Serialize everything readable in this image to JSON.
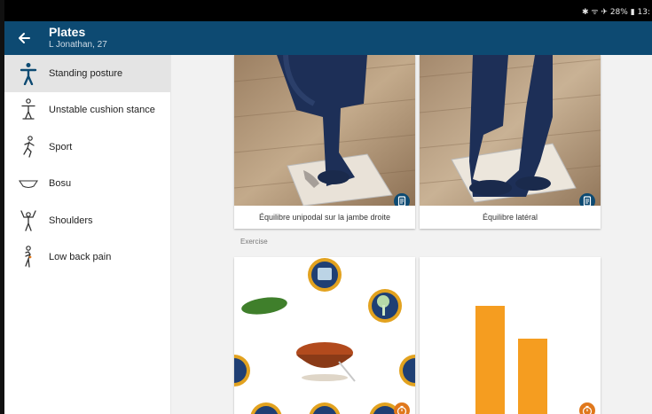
{
  "status_bar": {
    "text": "✱ ᯤ ✈ 28% ▮ 13:"
  },
  "app_bar": {
    "title": "Plates",
    "subtitle": "L Jonathan, 27",
    "back_icon": "arrow-left-icon"
  },
  "sidebar": {
    "items": [
      {
        "label": "Standing posture",
        "icon": "standing-figure-icon",
        "active": true
      },
      {
        "label": "Unstable cushion stance",
        "icon": "cushion-stance-icon",
        "active": false
      },
      {
        "label": "Sport",
        "icon": "running-figure-icon",
        "active": false
      },
      {
        "label": "Bosu",
        "icon": "bosu-icon",
        "active": false
      },
      {
        "label": "Shoulders",
        "icon": "shoulders-figure-icon",
        "active": false
      },
      {
        "label": "Low back pain",
        "icon": "back-pain-figure-icon",
        "active": false
      }
    ]
  },
  "cards": {
    "top_left": {
      "caption": "Équilibre unipodal sur la jambe droite",
      "badge_icon": "document-icon"
    },
    "top_right": {
      "caption": "Équilibre latéral",
      "badge_icon": "document-icon"
    }
  },
  "exercise_section": {
    "label": "Exercise"
  },
  "bottom_cards": {
    "left": {
      "badge_icon": "timer-icon",
      "image": "food-circles-illustration"
    },
    "right": {
      "badge_icon": "timer-icon"
    }
  },
  "chart_data": {
    "type": "bar",
    "categories": [
      "",
      ""
    ],
    "values": [
      135,
      98
    ],
    "title": "",
    "xlabel": "",
    "ylabel": "",
    "ylim": [
      0,
      175
    ]
  },
  "colors": {
    "app_bar": "#0d4a72",
    "accent_orange": "#f59d20",
    "badge_blue": "#0d4a72",
    "badge_orange": "#e0781c",
    "active_nav": "#e4e4e4"
  }
}
